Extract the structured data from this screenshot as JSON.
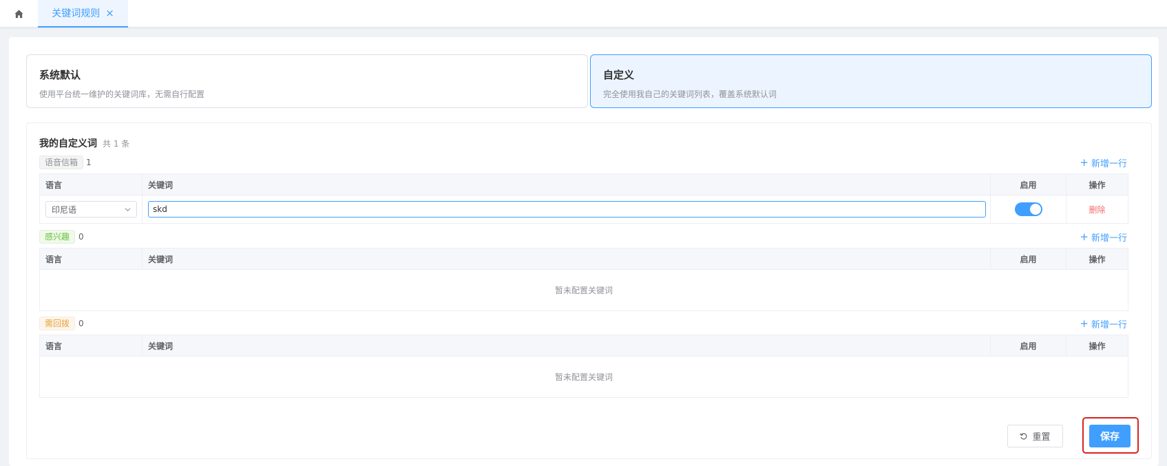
{
  "tabs": {
    "home_icon": "home-icon",
    "active_tab_label": "关键词规则",
    "close_glyph": "×"
  },
  "modes": {
    "system": {
      "title": "系统默认",
      "desc": "使用平台统一维护的关键词库，无需自行配置"
    },
    "custom": {
      "title": "自定义",
      "desc": "完全使用我自己的关键词列表，覆盖系统默认词",
      "selected": true
    }
  },
  "panel": {
    "title": "我的自定义词",
    "count": "共 1 条"
  },
  "columns": {
    "lang": "语言",
    "keyword": "关键词",
    "enabled": "启用",
    "action": "操作"
  },
  "add_row_label": "新增一行",
  "empty_text": "暂未配置关键词",
  "groups": [
    {
      "tag": "语音信箱",
      "count": "1",
      "rows": [
        {
          "lang": "印尼语",
          "keyword": "skd",
          "enabled": true,
          "action": "删除"
        }
      ]
    },
    {
      "tag": "感兴趣",
      "count": "0",
      "rows": []
    },
    {
      "tag": "需回拨",
      "count": "0",
      "rows": []
    }
  ],
  "buttons": {
    "reset": "重置",
    "save": "保存"
  },
  "colors": {
    "primary": "#409eff",
    "danger": "#f56c6c",
    "highlight_outline": "#d9231e",
    "tag_green": "#67c23a",
    "tag_orange": "#e6a23c"
  }
}
